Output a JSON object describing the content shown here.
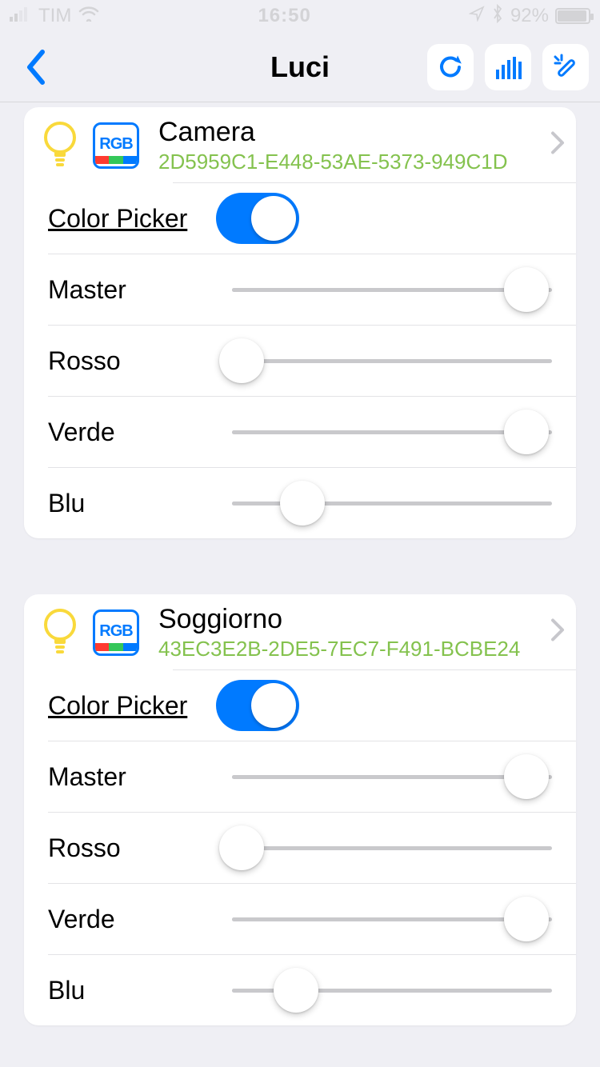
{
  "status": {
    "carrier": "TIM",
    "time": "16:50",
    "battery_pct": "92%"
  },
  "nav": {
    "title": "Luci"
  },
  "labels": {
    "color_picker": "Color Picker",
    "master": "Master",
    "rosso": "Rosso",
    "verde": "Verde",
    "blu": "Blu",
    "rgb": "RGB"
  },
  "devices": [
    {
      "name": "Camera",
      "id": "2D5959C1-E448-53AE-5373-949C1D",
      "color_picker_on": true,
      "sliders": {
        "master": 92,
        "rosso": 3,
        "verde": 92,
        "blu": 22
      }
    },
    {
      "name": "Soggiorno",
      "id": "43EC3E2B-2DE5-7EC7-F491-BCBE24",
      "color_picker_on": true,
      "sliders": {
        "master": 92,
        "rosso": 3,
        "verde": 92,
        "blu": 20
      }
    }
  ]
}
